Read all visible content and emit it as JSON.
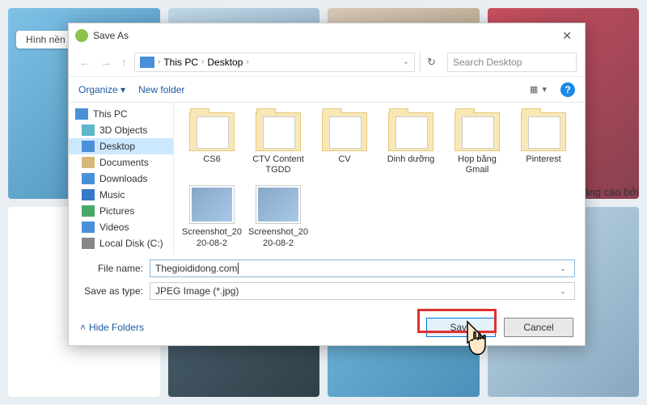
{
  "bg_tag": "Hình nền",
  "right_text": "ảng cáo bởi",
  "dialog": {
    "title": "Save As",
    "path": {
      "pc": "This PC",
      "loc": "Desktop"
    },
    "search_placeholder": "Search Desktop",
    "toolbar": {
      "organize": "Organize",
      "newfolder": "New folder"
    },
    "tree": {
      "root": "This PC",
      "items": [
        {
          "label": "3D Objects"
        },
        {
          "label": "Desktop"
        },
        {
          "label": "Documents"
        },
        {
          "label": "Downloads"
        },
        {
          "label": "Music"
        },
        {
          "label": "Pictures"
        },
        {
          "label": "Videos"
        },
        {
          "label": "Local Disk (C:)"
        }
      ]
    },
    "files": [
      {
        "name": "CS6",
        "type": "folder"
      },
      {
        "name": "CTV Content TGDD",
        "type": "folder"
      },
      {
        "name": "CV",
        "type": "folder"
      },
      {
        "name": "Dinh dưỡng",
        "type": "folder"
      },
      {
        "name": "Họp bằng Gmail",
        "type": "folder"
      },
      {
        "name": "Pinterest",
        "type": "folder"
      },
      {
        "name": "Screenshot_2020-08-2",
        "type": "image"
      },
      {
        "name": "Screenshot_2020-08-2",
        "type": "image"
      }
    ],
    "filename_label": "File name:",
    "filename_value": "Thegioididong.com",
    "type_label": "Save as type:",
    "type_value": "JPEG Image (*.jpg)",
    "hide_folders": "Hide Folders",
    "save": "Save",
    "cancel": "Cancel"
  }
}
